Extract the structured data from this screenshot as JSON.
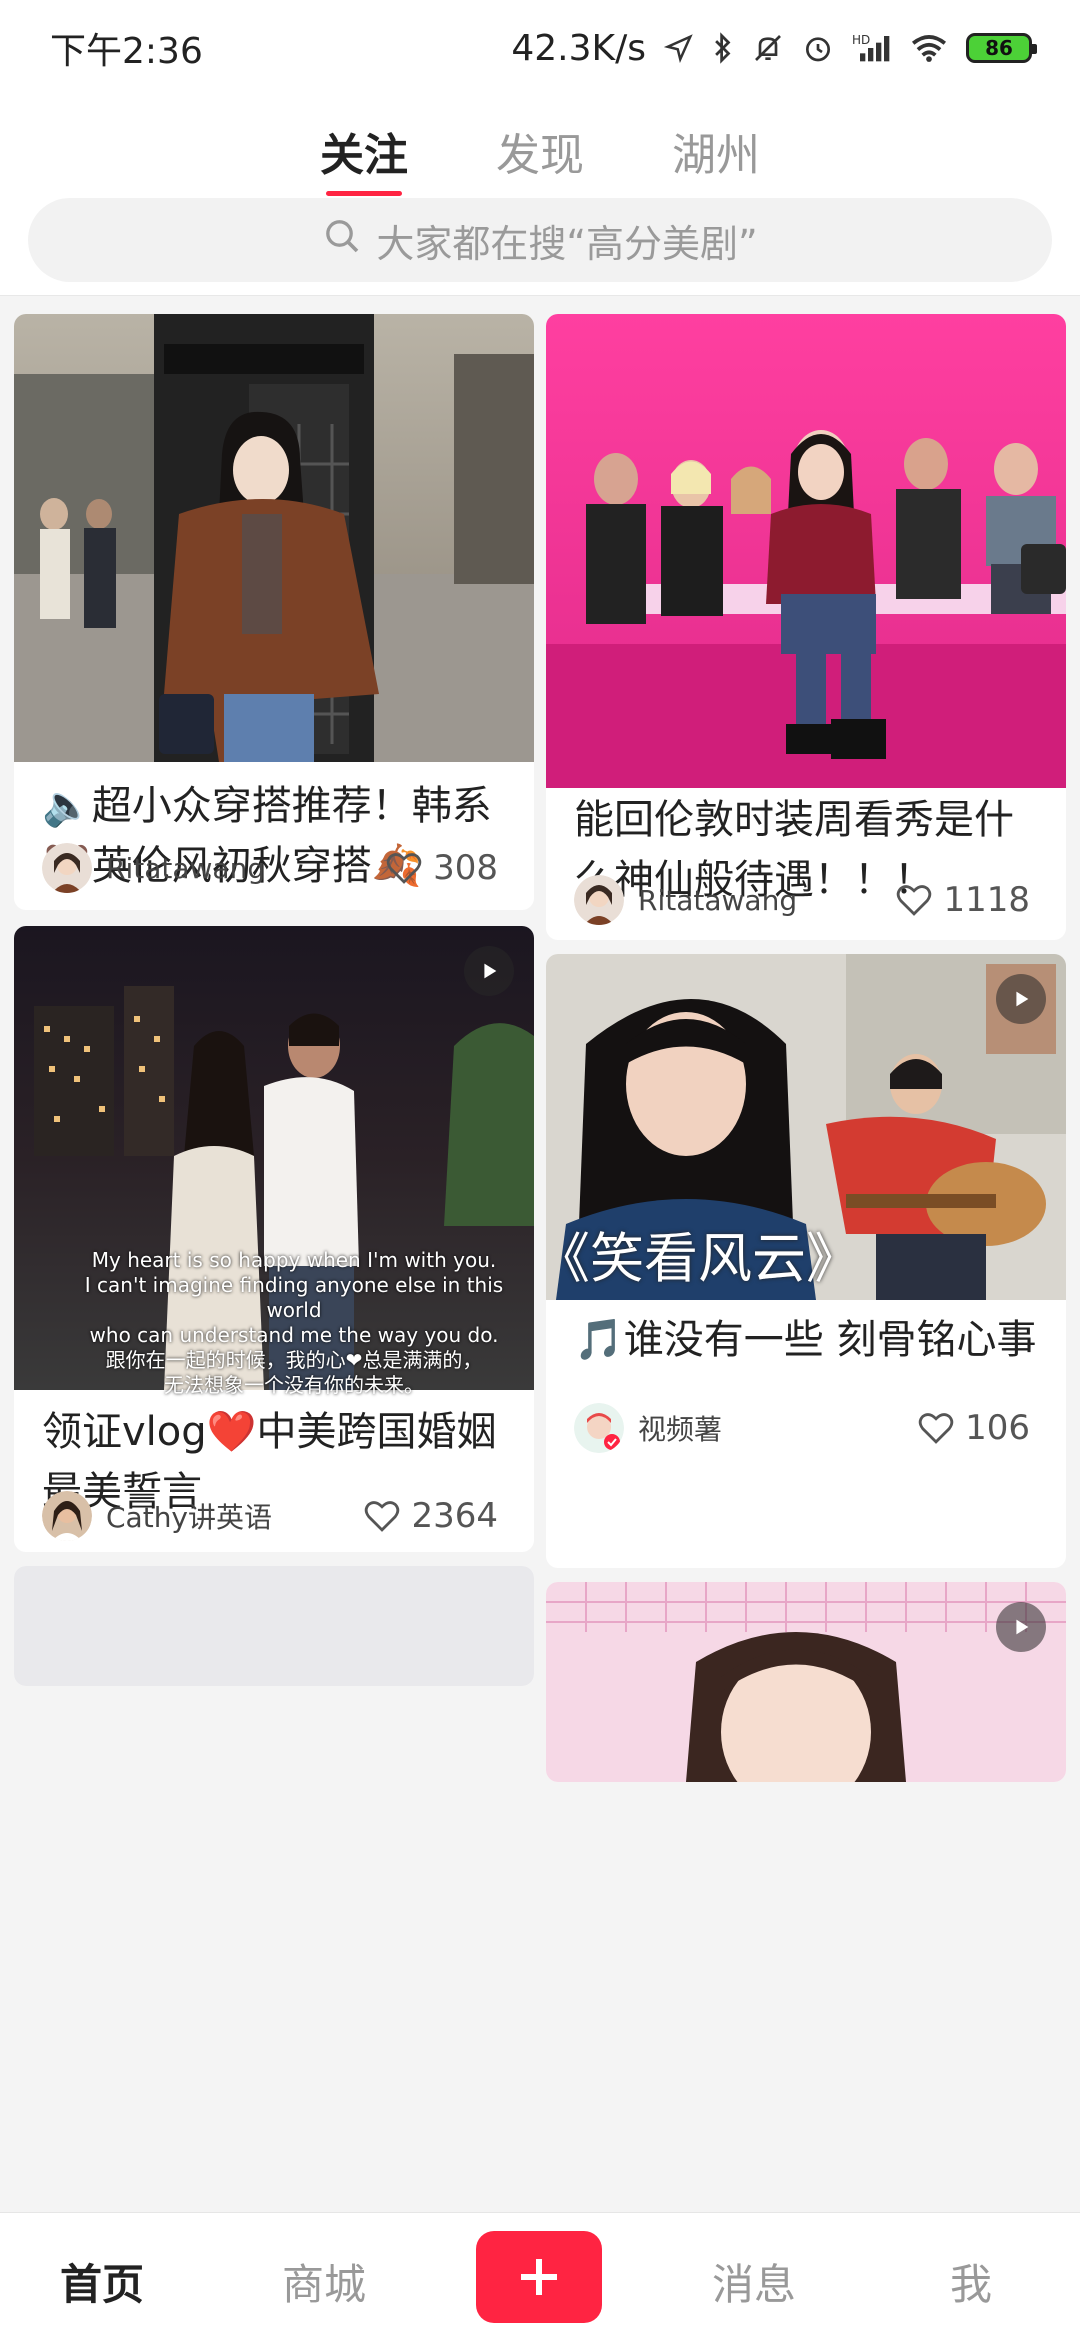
{
  "status_bar": {
    "time": "下午2:36",
    "network_speed": "42.3K/s",
    "battery_level": "86",
    "icons": [
      "location-icon",
      "bluetooth-icon",
      "mute-icon",
      "alarm-icon",
      "hd-signal-icon",
      "wifi-icon",
      "battery-icon"
    ]
  },
  "header": {
    "tabs": [
      {
        "label": "关注",
        "active": true
      },
      {
        "label": "发现",
        "active": false
      },
      {
        "label": "湖州",
        "active": false
      }
    ],
    "search": {
      "placeholder": "大家都在搜“高分美剧”"
    }
  },
  "feed": {
    "cards": [
      {
        "title": "🔈超小众穿搭推荐！韩系🐻英伦风初秋穿搭🍂",
        "author": "Ritatawang",
        "likes": "308",
        "is_video": false,
        "image_desc": "woman-in-brown-blazer-beside-phone-booth"
      },
      {
        "title": "能回伦敦时装周看秀是什么神仙般待遇！！！",
        "author": "Ritatawang",
        "likes": "1118",
        "is_video": false,
        "image_desc": "fashion-show-front-row-pink-lighting"
      },
      {
        "title": "领证vlog❤️中美跨国婚姻最美誓言",
        "author": "Cathy讲英语",
        "likes": "2364",
        "is_video": true,
        "overlay_caption": [
          "My heart is so happy when I'm with you.",
          "I can't imagine finding anyone else in this world",
          "who can understand me the way you do.",
          "跟你在一起的时候，我的心❤总是满满的，",
          "无法想象一个没有你的未来。"
        ]
      },
      {
        "title": "🎵谁没有一些 刻骨铭心事",
        "author": "视频薯",
        "likes": "106",
        "is_video": true,
        "overlay_caption": "《笑看风云》"
      },
      {
        "title": "",
        "author": "",
        "likes": "",
        "is_video": true
      }
    ]
  },
  "bottom_nav": {
    "items": [
      {
        "label": "首页",
        "active": true
      },
      {
        "label": "商城",
        "active": false
      },
      {
        "label": "消息",
        "active": false
      },
      {
        "label": "我",
        "active": false
      }
    ],
    "post_icon": "plus-icon"
  },
  "colors": {
    "accent": "#ff2442",
    "background": "#f4f4f4",
    "card": "#ffffff"
  }
}
